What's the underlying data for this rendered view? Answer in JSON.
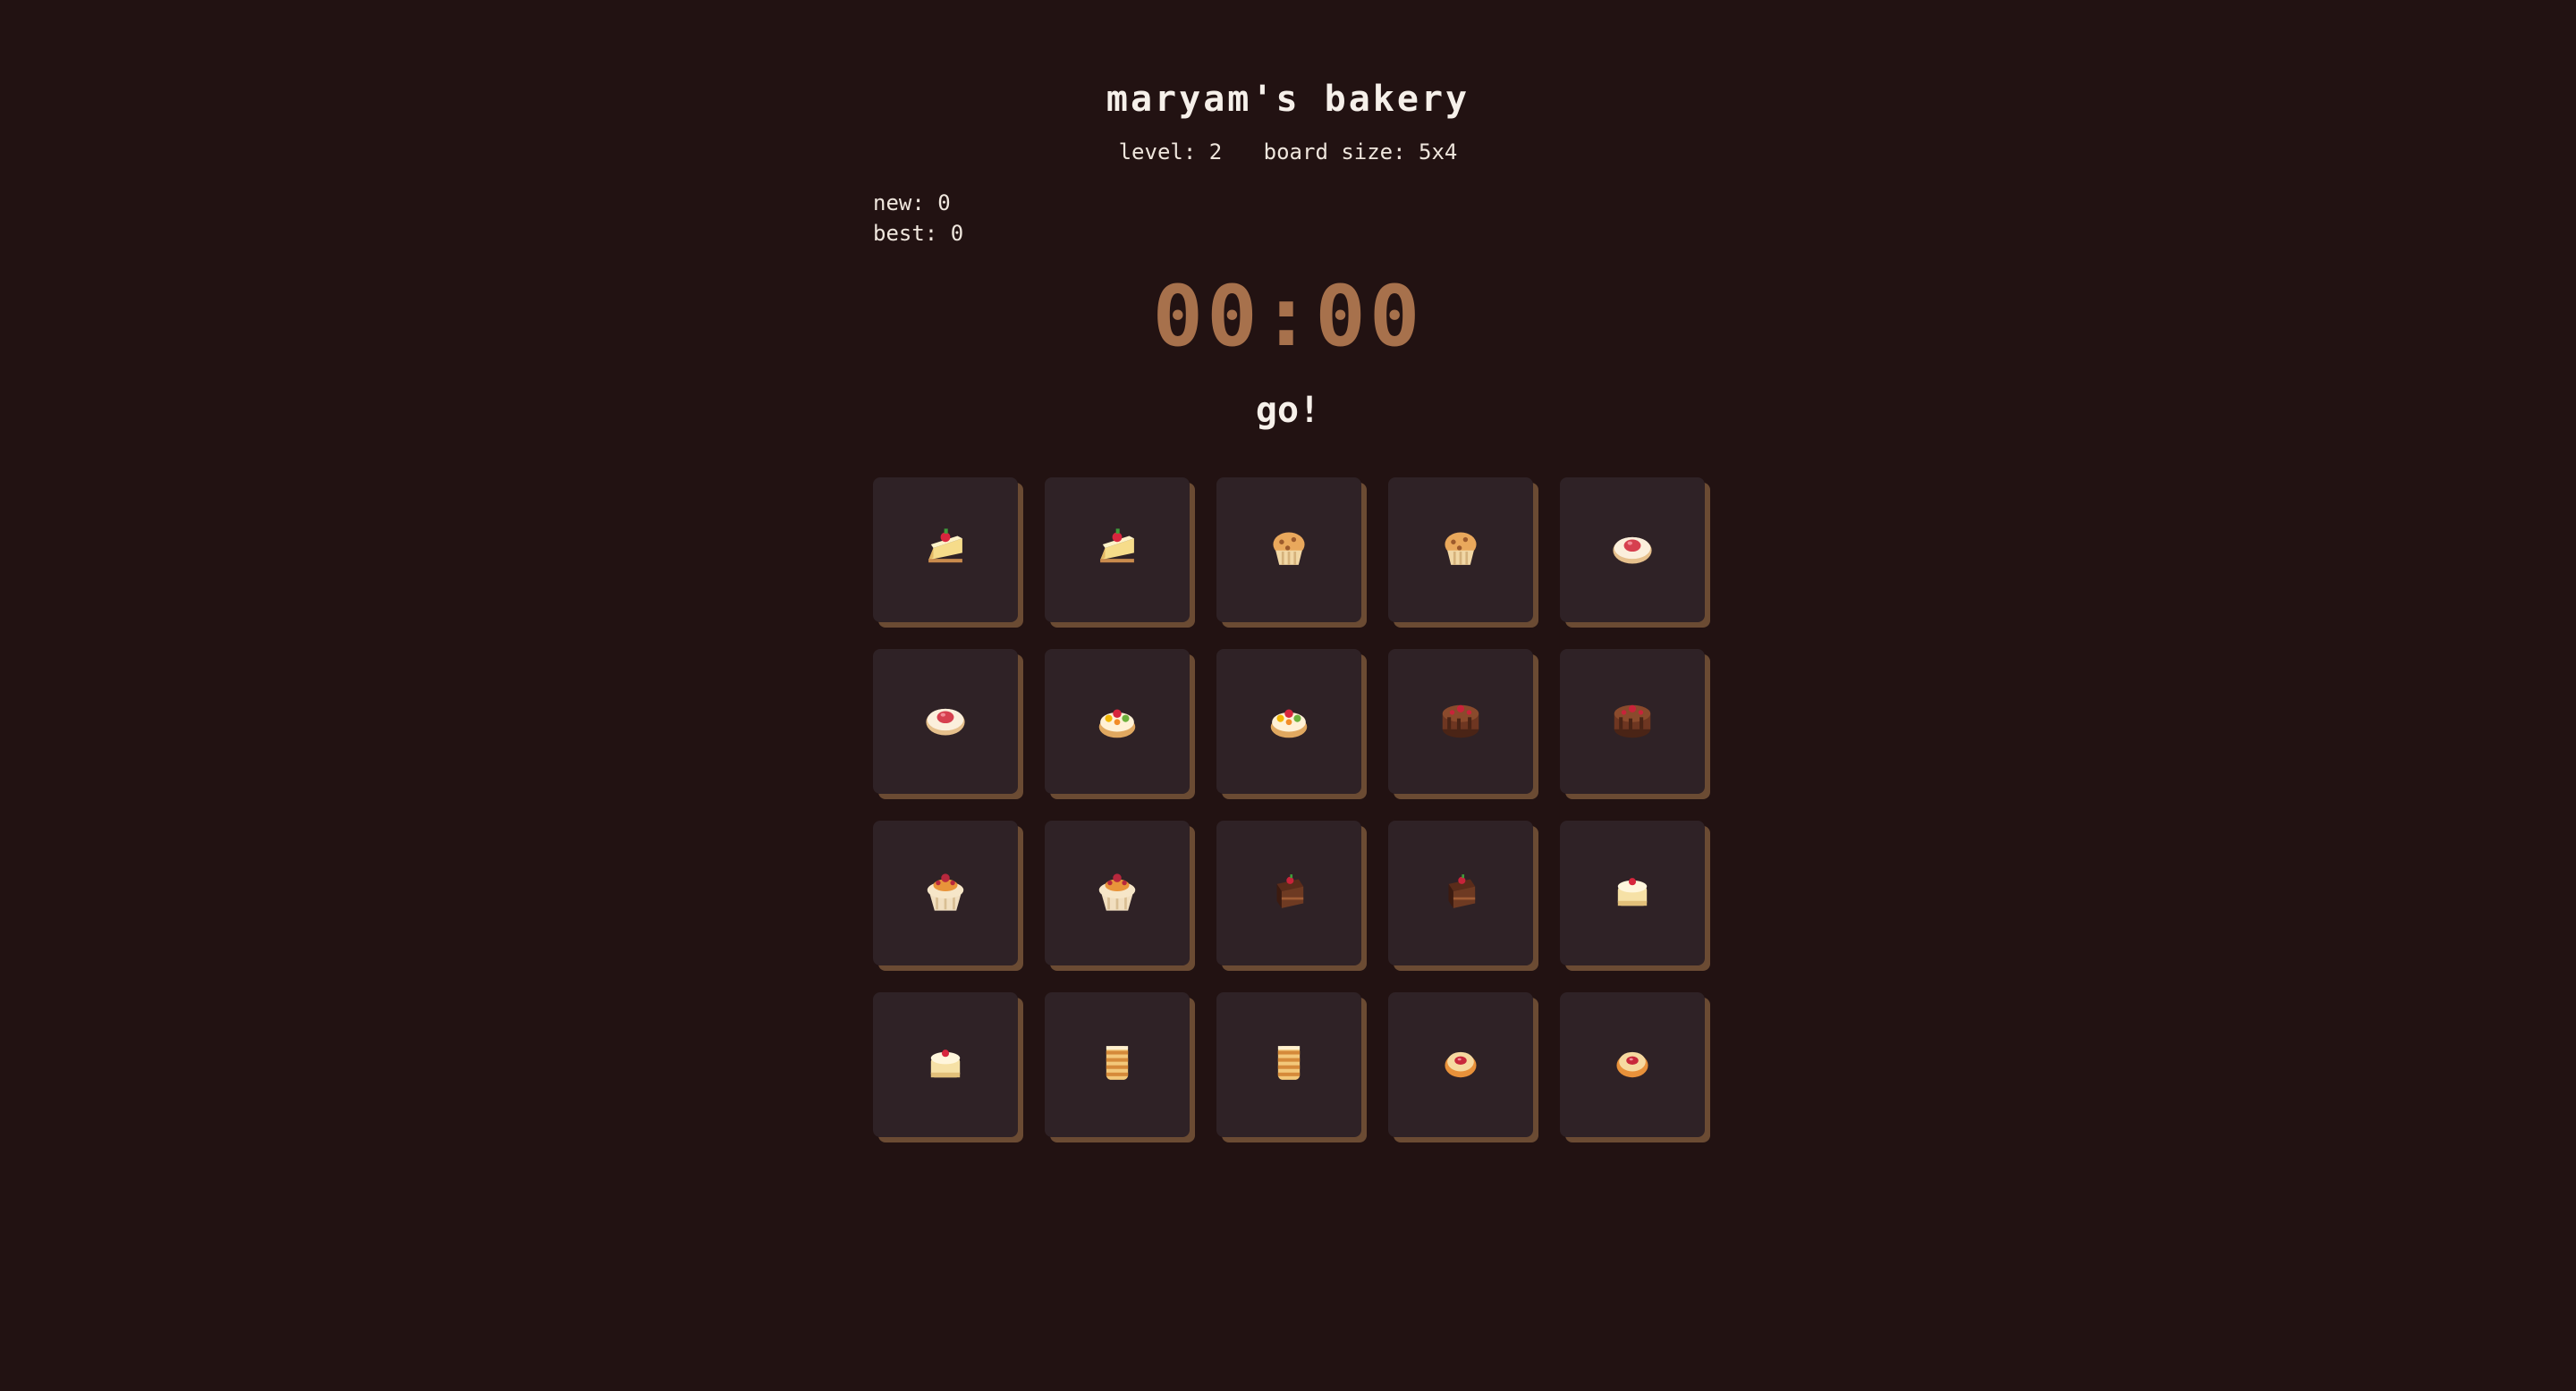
{
  "game": {
    "title": "maryam's bakery",
    "level_label": "level: 2",
    "board_label": "board size: 5x4",
    "scores": {
      "new_label": "new: 0",
      "best_label": "best: 0"
    },
    "timer": "00:00",
    "status": "go!"
  },
  "board": {
    "columns": 5,
    "rows": 4,
    "cards": [
      {
        "icon": "cake-slice-icon"
      },
      {
        "icon": "cake-slice-icon"
      },
      {
        "icon": "muffin-icon"
      },
      {
        "icon": "muffin-icon"
      },
      {
        "icon": "jam-cookie-icon"
      },
      {
        "icon": "jam-cookie-icon"
      },
      {
        "icon": "fruit-tart-icon"
      },
      {
        "icon": "fruit-tart-icon"
      },
      {
        "icon": "chocolate-cake-icon"
      },
      {
        "icon": "chocolate-cake-icon"
      },
      {
        "icon": "cupcake-icon"
      },
      {
        "icon": "cupcake-icon"
      },
      {
        "icon": "brownie-icon"
      },
      {
        "icon": "brownie-icon"
      },
      {
        "icon": "cream-bun-icon"
      },
      {
        "icon": "cream-bun-icon"
      },
      {
        "icon": "layer-cake-icon"
      },
      {
        "icon": "layer-cake-icon"
      },
      {
        "icon": "donut-icon"
      },
      {
        "icon": "donut-icon"
      }
    ]
  },
  "colors": {
    "background": "#221212",
    "card": "#2f2226",
    "card_shadow": "#6b4b33",
    "timer": "#a7714c",
    "text": "#f3ece4"
  }
}
